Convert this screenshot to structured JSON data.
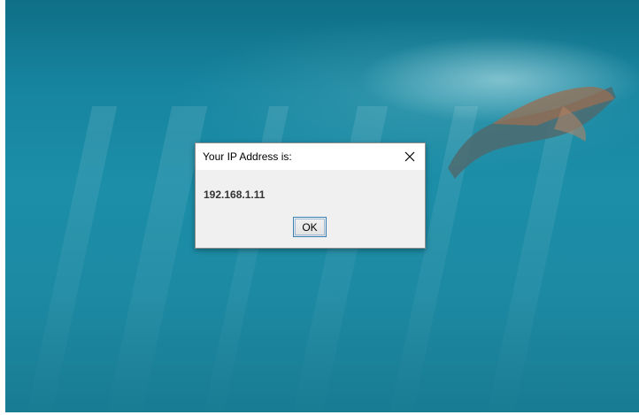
{
  "dialog": {
    "title": "Your IP Address is:",
    "message": "192.168.1.11",
    "ok_label": "OK"
  },
  "icons": {
    "close": "close-icon"
  },
  "colors": {
    "wallpaper_water": "#1c8ea8",
    "dialog_body": "#f0f0f0",
    "titlebar": "#ffffff",
    "button_focus_border": "#3c7fb1"
  }
}
